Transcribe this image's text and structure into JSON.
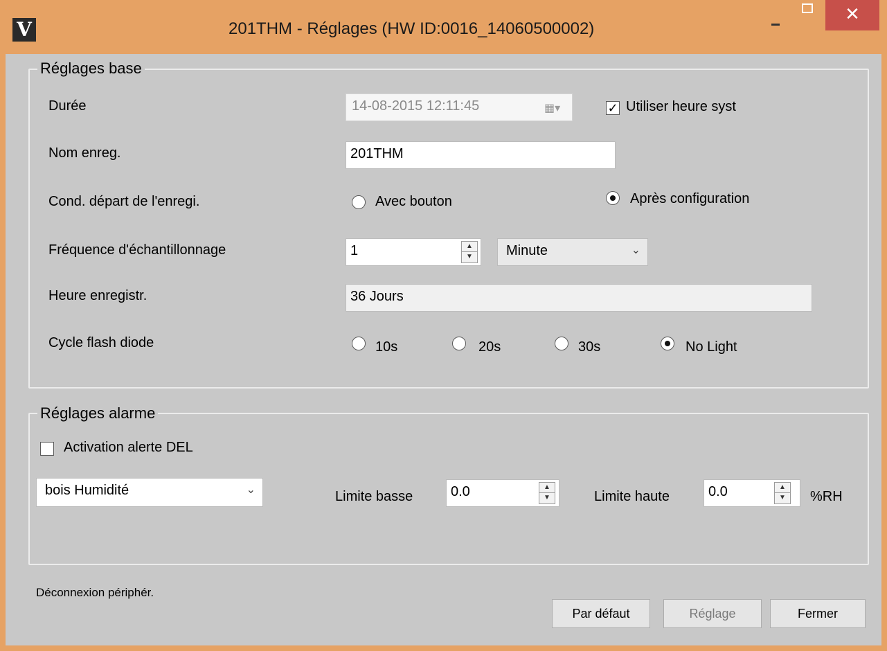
{
  "window": {
    "logo": "V",
    "title": "201THM - Réglages (HW ID:0016_14060500002)",
    "close_glyph": "✕"
  },
  "base": {
    "group_title": "Réglages base",
    "duree": {
      "label": "Durée",
      "value": "14-08-2015 12:11:45",
      "system_time_label": "Utiliser heure syst",
      "system_time_checked": true
    },
    "nom": {
      "label": "Nom enreg.",
      "value": "201THM"
    },
    "cond": {
      "label": "Cond. départ de l'enregi.",
      "options": [
        "Avec bouton",
        "Après configuration"
      ],
      "selected": "Après configuration"
    },
    "freq": {
      "label": "Fréquence d'échantillonnage",
      "value": "1",
      "unit": "Minute"
    },
    "heure": {
      "label": "Heure enregistr.",
      "value": "36 Jours"
    },
    "flash": {
      "label": "Cycle flash diode",
      "options": [
        "10s",
        "20s",
        "30s",
        "No Light"
      ],
      "selected": "No Light"
    }
  },
  "alarm": {
    "group_title": "Réglages alarme",
    "led_alert_label": "Activation alerte DEL",
    "led_alert_checked": false,
    "sensor": "bois Humidité",
    "low_label": "Limite basse",
    "low_value": "0.0",
    "high_label": "Limite haute",
    "high_value": "0.0",
    "unit": "%RH"
  },
  "footer": {
    "status": "Déconnexion périphér.",
    "default_label": "Par défaut",
    "apply_label": "Réglage",
    "close_label": "Fermer"
  }
}
